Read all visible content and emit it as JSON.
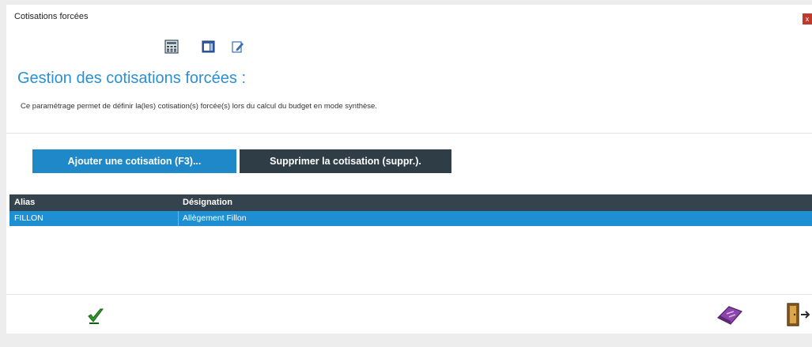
{
  "window": {
    "title": "Cotisations forcées",
    "close_label": "x"
  },
  "toolbar": {
    "icons": [
      "calculator-icon",
      "preview-icon",
      "edit-icon"
    ]
  },
  "heading": "Gestion des cotisations forcées :",
  "description": "Ce paramétrage permet de définir la(les) cotisation(s) forcée(s) lors du calcul du budget en mode synthèse.",
  "buttons": {
    "add": "Ajouter une cotisation (F3)...",
    "delete": "Supprimer la cotisation (suppr.)."
  },
  "grid": {
    "columns": [
      "Alias",
      "Désignation"
    ],
    "rows": [
      {
        "alias": "FILLON",
        "designation": "Allègement Fillon",
        "selected": true
      }
    ]
  },
  "footer": {
    "icons": [
      "validate-checkmark-icon",
      "eraser-icon",
      "exit-door-icon"
    ]
  },
  "colors": {
    "accent": "#1e88c8",
    "header_dark": "#34434d",
    "selected_row": "#1e8fd3",
    "heading": "#2a90d6",
    "close": "#c0392b"
  }
}
